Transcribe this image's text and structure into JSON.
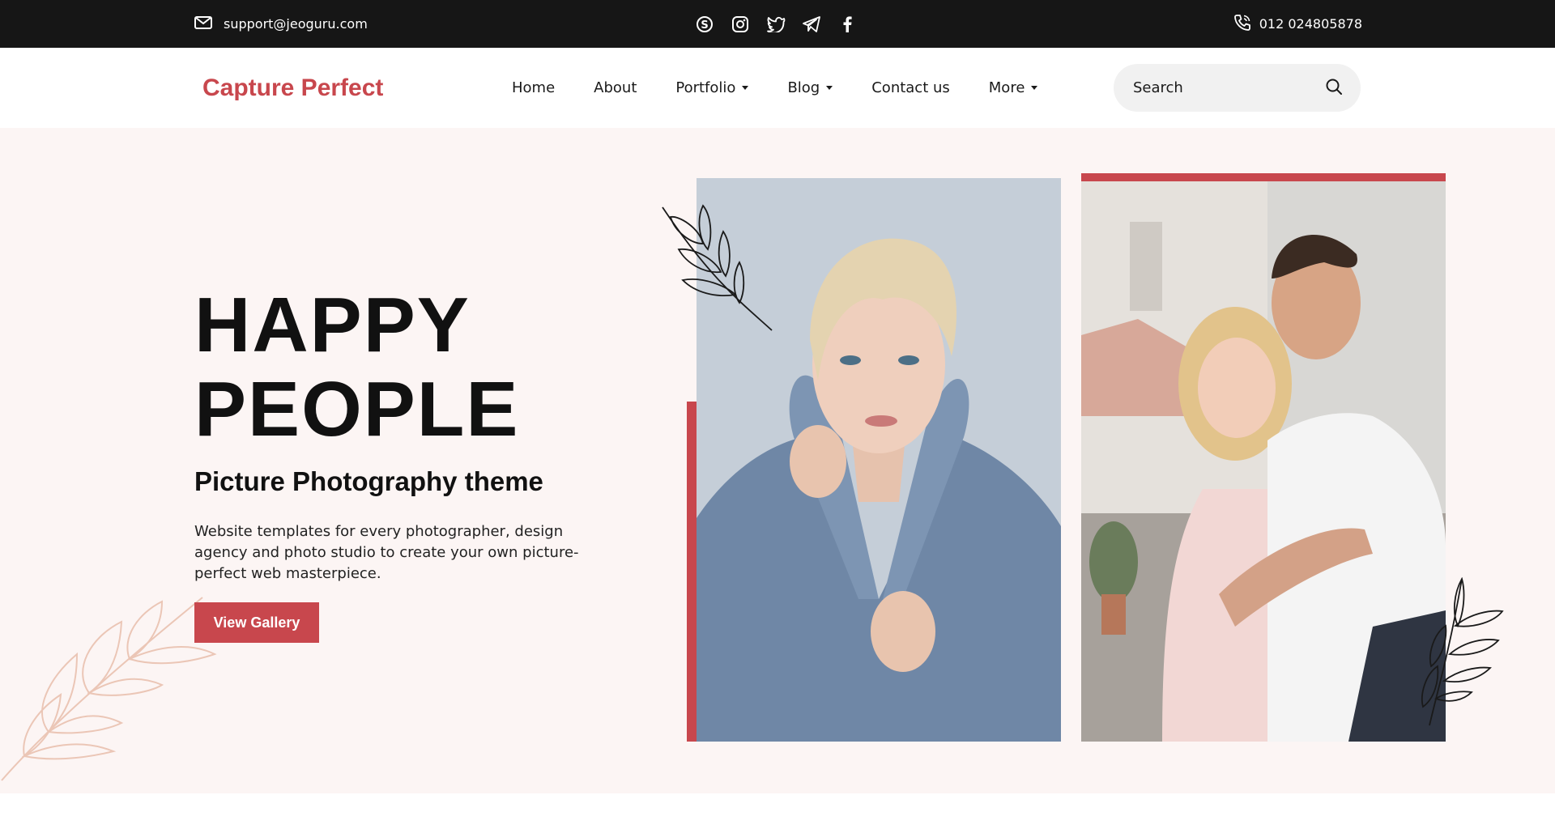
{
  "topbar": {
    "email": "support@jeoguru.com",
    "phone": "012 024805878",
    "social_icons": [
      "skype-icon",
      "instagram-icon",
      "twitter-icon",
      "telegram-icon",
      "facebook-icon"
    ]
  },
  "header": {
    "logo": "Capture Perfect",
    "nav": [
      {
        "label": "Home",
        "dropdown": false
      },
      {
        "label": "About",
        "dropdown": false
      },
      {
        "label": "Portfolio",
        "dropdown": true
      },
      {
        "label": "Blog",
        "dropdown": true
      },
      {
        "label": "Contact us",
        "dropdown": false
      },
      {
        "label": "More",
        "dropdown": true
      }
    ],
    "search_placeholder": "Search"
  },
  "hero": {
    "title_line1": "HAPPY",
    "title_line2": "PEOPLE",
    "subtitle": "Picture Photography theme",
    "description": "Website templates for every photographer, design agency and photo studio to create your own picture-perfect web masterpiece.",
    "cta": "View Gallery"
  },
  "colors": {
    "accent": "#c8474d",
    "topbar_bg": "#161616",
    "hero_bg": "#fcf5f4",
    "leaf_light": "#ebc6b6"
  }
}
